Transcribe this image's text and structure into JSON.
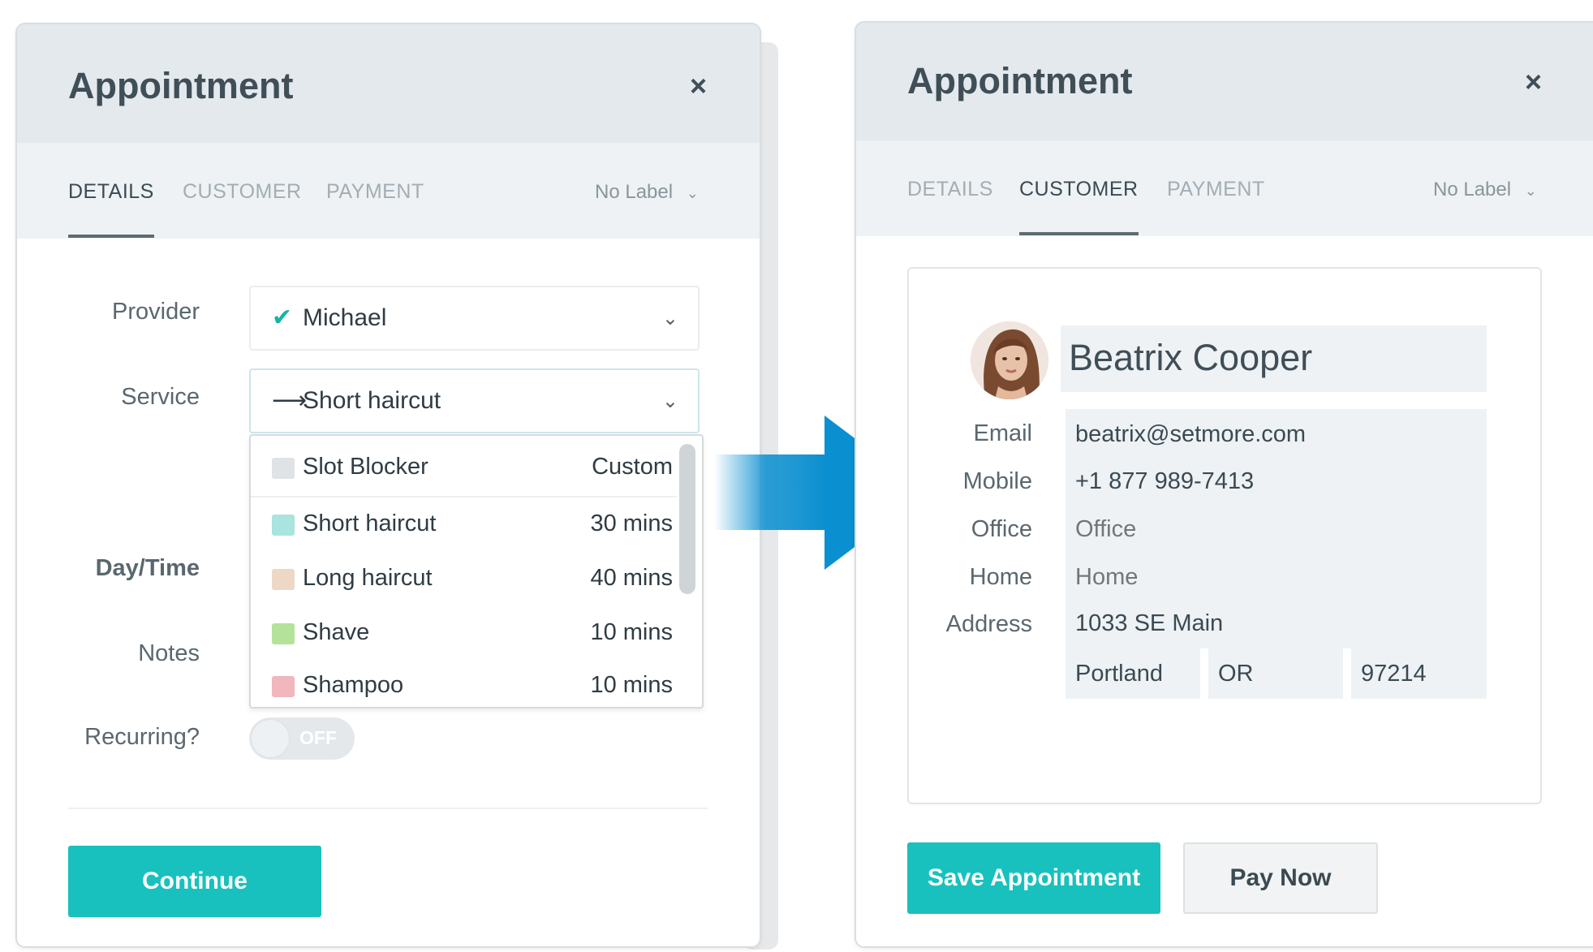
{
  "left_panel": {
    "title": "Appointment",
    "close": "×",
    "tabs": [
      {
        "label": "DETAILS",
        "active": true
      },
      {
        "label": "CUSTOMER",
        "active": false
      },
      {
        "label": "PAYMENT",
        "active": false
      }
    ],
    "no_label": "No Label",
    "provider": {
      "label": "Provider",
      "value": "Michael"
    },
    "service": {
      "label": "Service",
      "value": "Short haircut"
    },
    "service_options": [
      {
        "name": "Slot Blocker",
        "duration": "Custom",
        "color": "#e0e3e5"
      },
      {
        "name": "Short haircut",
        "duration": "30 mins",
        "color": "#a9e4df"
      },
      {
        "name": "Long haircut",
        "duration": "40 mins",
        "color": "#ecd8c5"
      },
      {
        "name": "Shave",
        "duration": "10 mins",
        "color": "#b4e29a"
      },
      {
        "name": "Shampoo",
        "duration": "10 mins",
        "color": "#f2b6bd"
      }
    ],
    "day_time_label": "Day/Time",
    "notes_label": "Notes",
    "recurring": {
      "label": "Recurring?",
      "state": "OFF"
    },
    "continue_label": "Continue"
  },
  "right_panel": {
    "title": "Appointment",
    "close": "×",
    "tabs": [
      {
        "label": "DETAILS",
        "active": false
      },
      {
        "label": "CUSTOMER",
        "active": true
      },
      {
        "label": "PAYMENT",
        "active": false
      }
    ],
    "no_label": "No Label",
    "customer": {
      "name": "Beatrix Cooper",
      "email_label": "Email",
      "email": "beatrix@setmore.com",
      "mobile_label": "Mobile",
      "mobile": "+1 877 989-7413",
      "office_label": "Office",
      "office_placeholder": "Office",
      "home_label": "Home",
      "home_placeholder": "Home",
      "address_label": "Address",
      "address": "1033 SE Main",
      "city": "Portland",
      "state": "OR",
      "zip": "97214"
    },
    "save_label": "Save Appointment",
    "pay_label": "Pay Now"
  },
  "colors": {
    "accent": "#18c1bd",
    "arrow": "#0a8fd0",
    "header_bg": "#e3e9ed"
  }
}
